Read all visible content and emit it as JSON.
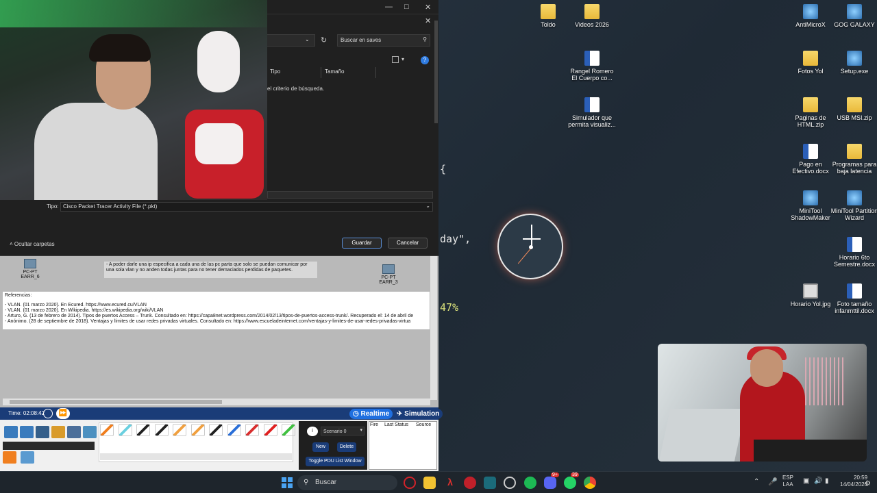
{
  "desktop": {
    "icons": [
      {
        "label": "Toldo",
        "type": "folder"
      },
      {
        "label": "Videos 2026",
        "type": "folder"
      },
      {
        "label": "AntiMicroX",
        "type": "exe"
      },
      {
        "label": "GOG GALAXY",
        "type": "exe"
      },
      {
        "label": "Rangel Romero El Cuerpo co...",
        "type": "word"
      },
      {
        "label": "Fotos Yol",
        "type": "folder"
      },
      {
        "label": "Setup.exe",
        "type": "exe"
      },
      {
        "label": "Simulador que permita visualiz...",
        "type": "word"
      },
      {
        "label": "Paginas de HTML.zip",
        "type": "folder"
      },
      {
        "label": "USB MSI.zip",
        "type": "folder"
      },
      {
        "label": "Pago en Efectivo.docx",
        "type": "word"
      },
      {
        "label": "Programas para baja latencia",
        "type": "folder"
      },
      {
        "label": "MiniTool ShadowMaker",
        "type": "exe"
      },
      {
        "label": "MiniTool Partition Wizard",
        "type": "exe"
      },
      {
        "label": "Horario 6to Semestre.docx",
        "type": "word"
      },
      {
        "label": "Horario Yol.jpg",
        "type": "img"
      },
      {
        "label": "Foto tamaño infanmttil.docx",
        "type": "word"
      }
    ],
    "code_fragments": [
      "{",
      "day\",",
      "47%"
    ]
  },
  "save_dialog": {
    "search_placeholder": "Buscar en saves",
    "col_type": "Tipo",
    "col_size": "Tamaño",
    "empty_msg": "el criterio de búsqueda.",
    "type_label": "Tipo:",
    "type_value": "Cisco Packet Tracer Activity File (*.pkt)",
    "hide_folders": "Ocultar carpetas",
    "save_btn": "Guardar",
    "cancel_btn": "Cancelar"
  },
  "packet_tracer": {
    "note_line1": "- A poder darle una ip especifica a cada una de las pc parta que solo se puedan comunicar por",
    "note_line2": "una sola vlan y no anden todas juntas para no tener demaciados perdidas de paquetes.",
    "pc_left": {
      "model": "PC-PT",
      "name": "EARR_6"
    },
    "pc_right": {
      "model": "PC-PT",
      "name": "EARR_3"
    },
    "refs_title": "Referencias:",
    "refs": [
      "- VLAN. (01 marzo 2020). En Ecured. https://www.ecured.cu/VLAN",
      "- VLAN. (01 marzo 2020). En Wikipedia. https://es.wikipedia.org/wiki/VLAN",
      "- Arturo, G. (13 de febrero de 2014). Tipos de puertos Access – Trunk. Consultado en: https://capa8net.wordpress.com/2014/02/13/tipos-de-puertos-access-trunk/. Recuperado el: 14 de abril de",
      "- Anónimo. (28 de septiembre de 2018). Ventajas y límites de usar redes privadas virtuales. Consultado en: https://www.escueladeinternet.com/ventajas-y-limites-de-usar-redes-privadas-virtua"
    ],
    "time": "Time: 02:08:42",
    "realtime": "Realtime",
    "simulation": "Simulation",
    "scenario": "Scenario 0",
    "new_btn": "New",
    "delete_btn": "Delete",
    "toggle_pdu": "Toggle PDU List Window",
    "pdu_cols": [
      "Fire",
      "Last Status",
      "Source"
    ]
  },
  "taskbar": {
    "search": "Buscar",
    "lang1": "ESP",
    "lang2": "LAA",
    "time": "20:59",
    "date": "14/04/2026",
    "whatsapp_badge": "39",
    "discord_badge": "9+"
  }
}
